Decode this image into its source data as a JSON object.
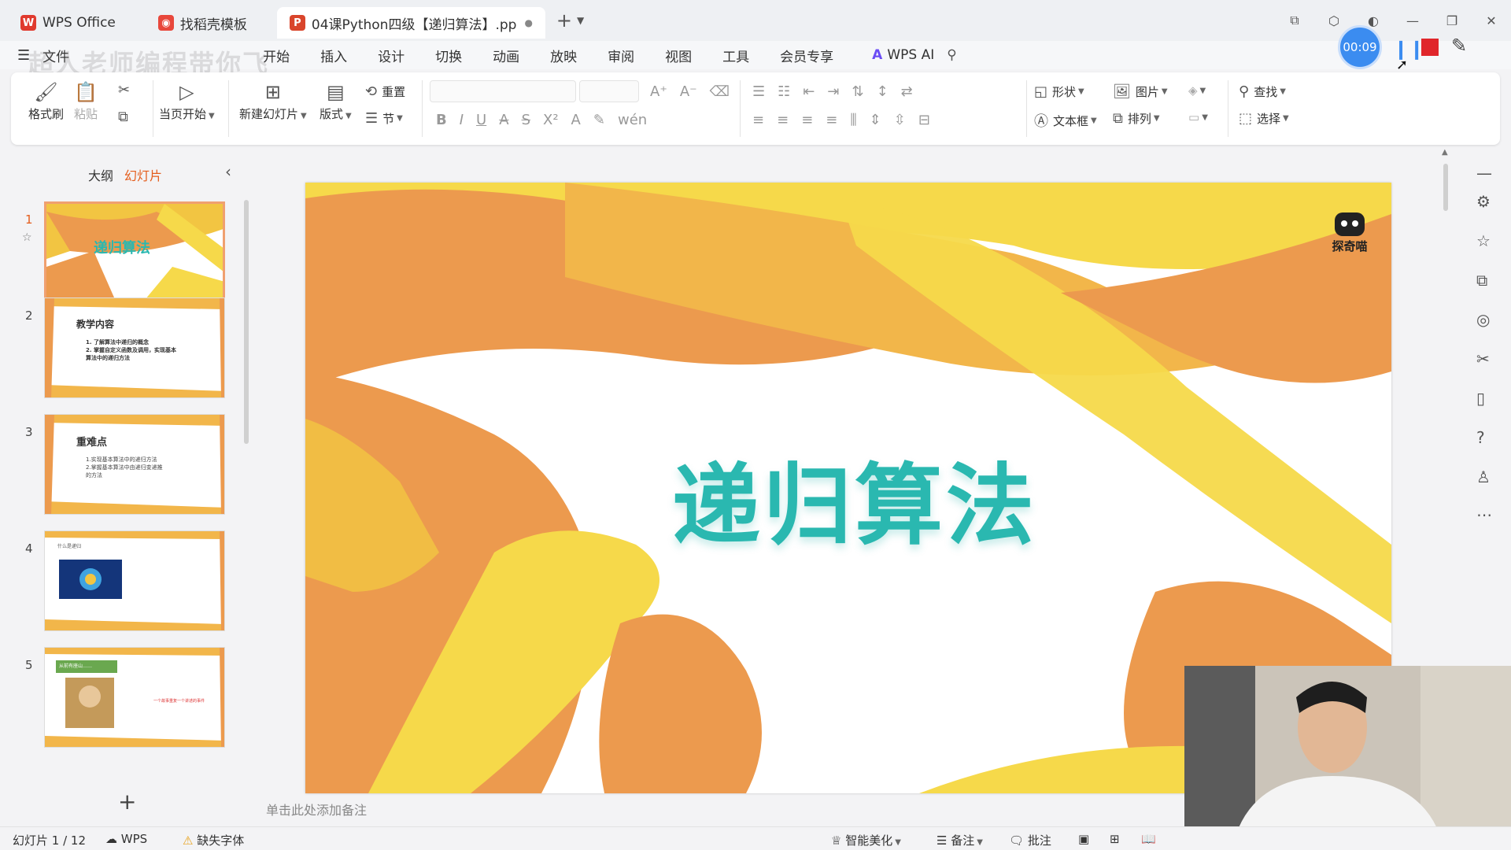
{
  "titlebar": {
    "tabs": [
      {
        "label": "WPS Office",
        "icon": "wps-logo-icon"
      },
      {
        "label": "找稻壳模板",
        "icon": "docer-icon"
      },
      {
        "label": "04课Python四级【递归算法】.pp",
        "icon": "ppt-file-icon",
        "active": true
      }
    ]
  },
  "recorder": {
    "time": "00:09"
  },
  "watermark": "超人老师编程带你飞",
  "menu": {
    "file": "文件",
    "items": [
      "开始",
      "插入",
      "设计",
      "切换",
      "动画",
      "放映",
      "审阅",
      "视图",
      "工具",
      "会员专享"
    ],
    "active": "开始",
    "wps_ai": "WPS AI"
  },
  "ribbon": {
    "format_painter": "格式刷",
    "paste": "粘贴",
    "from_current": "当页开始",
    "new_slide": "新建幻灯片",
    "layout": "版式",
    "reset": "重置",
    "section": "节",
    "shape": "形状",
    "picture": "图片",
    "find": "查找",
    "textbox": "文本框",
    "arrange": "排列",
    "select": "选择"
  },
  "left_panel": {
    "tab_outline": "大纲",
    "tab_slides": "幻灯片",
    "thumbs": [
      {
        "num": "1",
        "title": "递归算法"
      },
      {
        "num": "2",
        "title": "教学内容",
        "lines": [
          "1. 了解算法中递归的概念",
          "2. 掌握自定义函数及调用，实现基本",
          "算法中的递归方法"
        ]
      },
      {
        "num": "3",
        "title": "重难点",
        "lines": [
          "1.实现基本算法中的递归方法",
          "2.掌握基本算法中由递归变递推",
          "的方法"
        ]
      },
      {
        "num": "4",
        "title": "什么是递归"
      },
      {
        "num": "5",
        "title": "从前有座山……",
        "red_text": "一个故事重复一个讲述的事件"
      }
    ]
  },
  "slide": {
    "title": "递归算法",
    "logo_text": "探奇喵",
    "notes_placeholder": "单击此处添加备注"
  },
  "statusbar": {
    "slide_info": "幻灯片 1 / 12",
    "wps": "WPS",
    "missing_font": "缺失字体",
    "beautify": "智能美化",
    "notes": "备注",
    "comments": "批注"
  },
  "colors": {
    "accent": "#e45d1c",
    "title_teal": "#2ab8b0",
    "paint_orange": "#ec9a4e",
    "paint_yellow": "#f6d94a"
  }
}
